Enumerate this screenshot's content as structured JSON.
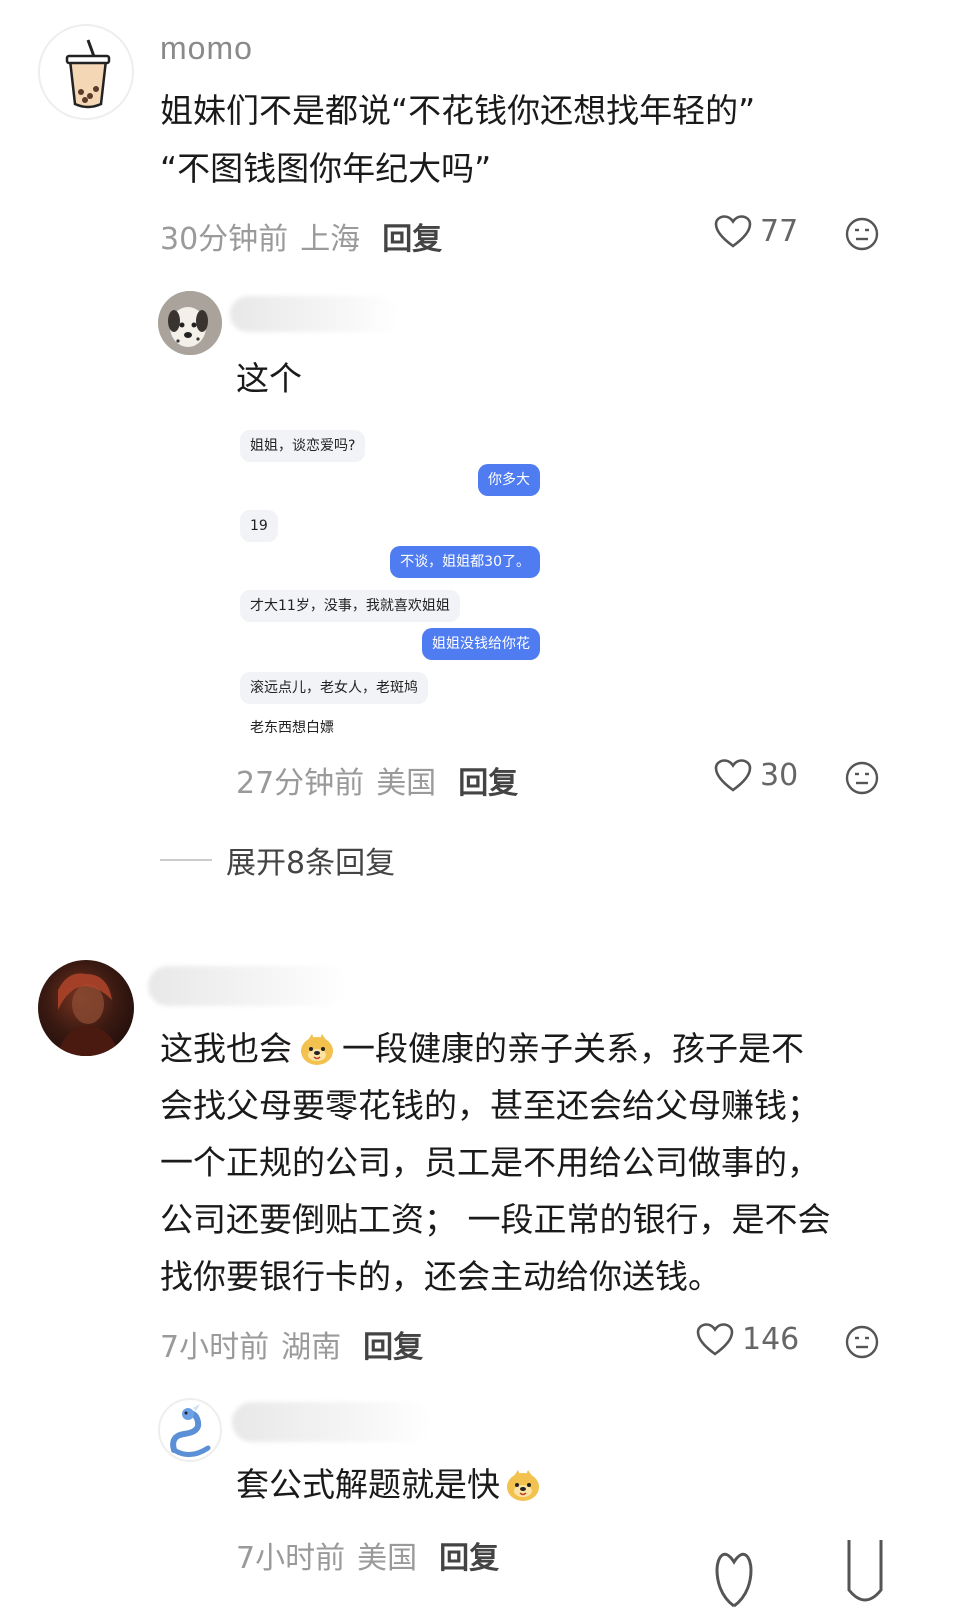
{
  "comments": [
    {
      "username": "momo",
      "text_line1": "姐妹们不是都说“不花钱你还想找年轻的”",
      "text_line2": "“不图钱图你年纪大吗”",
      "time": "30分钟前",
      "location": "上海",
      "reply_label": "回复",
      "likes": "77"
    },
    {
      "text": "这个",
      "time": "27分钟前",
      "location": "美国",
      "reply_label": "回复",
      "likes": "30",
      "chat_image": {
        "messages": [
          {
            "side": "left",
            "text": "姐姐，谈恋爱吗?"
          },
          {
            "side": "right",
            "text": "你多大"
          },
          {
            "side": "left",
            "text": "19"
          },
          {
            "side": "right",
            "text": "不谈，姐姐都30了。"
          },
          {
            "side": "left",
            "text": "才大11岁，没事，我就喜欢姐姐"
          },
          {
            "side": "right",
            "text": "姐姐没钱给你花"
          },
          {
            "side": "left",
            "text": "滚远点儿，老女人，老斑鸠"
          },
          {
            "side": "left",
            "text": "老东西想白嫖"
          }
        ]
      }
    },
    {
      "expand_label": "展开8条回复"
    },
    {
      "lines": [
        "这我也会",
        "一段健康的亲子关系，孩子是不",
        "会找父母要零花钱的，甚至还会给父母赚钱；",
        "一个正规的公司，员工是不用给公司做事的，",
        "公司还要倒贴工资； 一段正常的银行，是不会",
        "找你要银行卡的，还会主动给你送钱。"
      ],
      "time": "7小时前",
      "location": "湖南",
      "reply_label": "回复",
      "likes": "146"
    },
    {
      "text": "套公式解题就是快",
      "time": "7小时前",
      "location": "美国",
      "reply_label": "回复"
    }
  ],
  "icons": {
    "like": "heart-outline-icon",
    "dislike": "neutral-face-icon",
    "emoji": "doge-emoji-icon"
  },
  "colors": {
    "meta_gray": "#9a9a9a",
    "chat_blue": "#4f7cf0"
  }
}
